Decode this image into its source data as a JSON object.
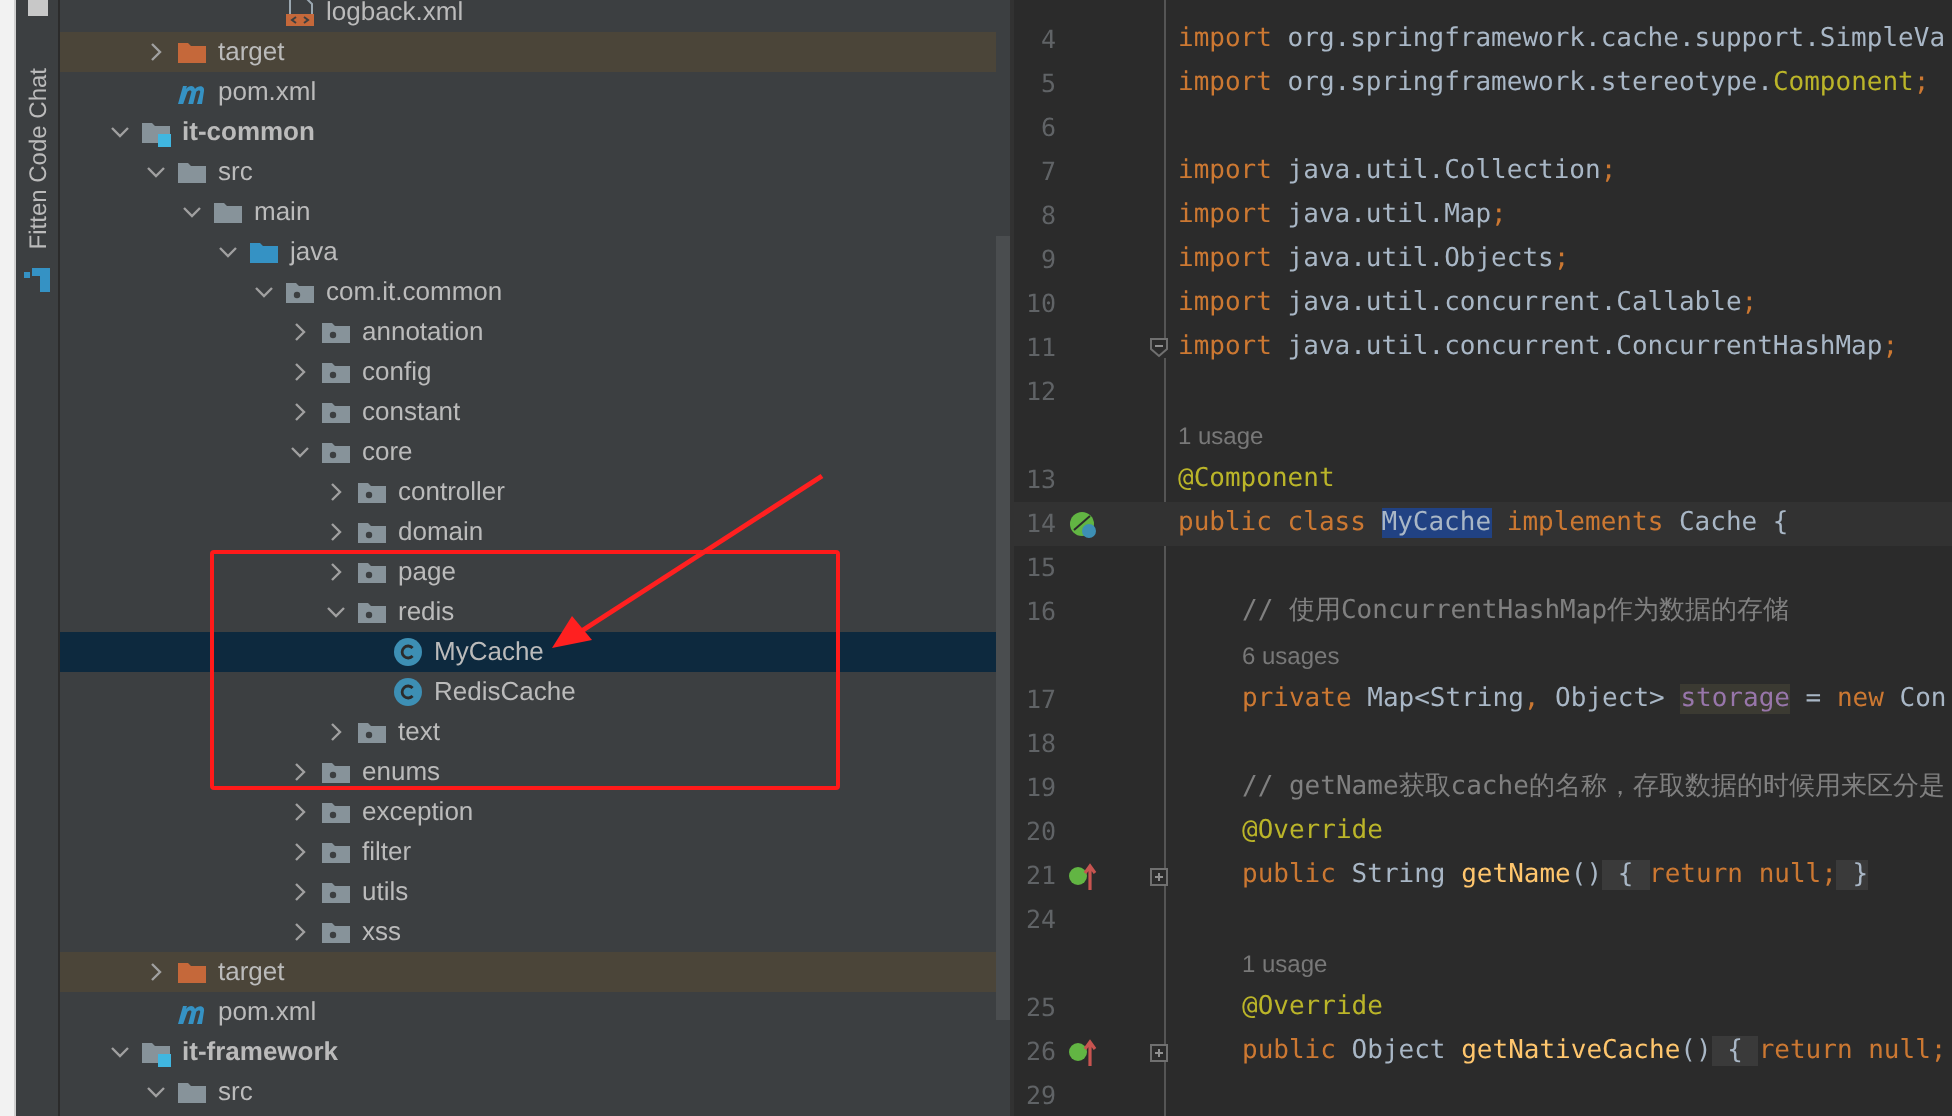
{
  "tool_strip": {
    "tabs": [
      {
        "label": "Fitten Code Chat"
      }
    ]
  },
  "project_tree": {
    "items": [
      {
        "children": [
          {
            "children": [
              {
                "children": [
                  {
                    "children": [
                      {
                        "label": "logback.xml",
                        "kind": "xml",
                        "selected": false
                      }
                    ]
                  }
                ]
              }
            ]
          },
          {
            "label": "target",
            "kind": "excluded-folder",
            "expanded": false,
            "selected": false
          },
          {
            "label": "pom.xml",
            "kind": "maven",
            "selected": false
          }
        ]
      },
      {
        "label": "it-common",
        "kind": "module",
        "expanded": true,
        "selected": false,
        "children": [
          {
            "label": "src",
            "kind": "folder",
            "expanded": true,
            "selected": false,
            "children": [
              {
                "label": "main",
                "kind": "folder",
                "expanded": true,
                "selected": false,
                "children": [
                  {
                    "label": "java",
                    "kind": "source-folder",
                    "expanded": true,
                    "selected": false,
                    "children": [
                      {
                        "label": "com.it.common",
                        "kind": "package",
                        "expanded": true,
                        "selected": false,
                        "children": [
                          {
                            "label": "annotation",
                            "kind": "package",
                            "expanded": false,
                            "selected": false
                          },
                          {
                            "label": "config",
                            "kind": "package",
                            "expanded": false,
                            "selected": false
                          },
                          {
                            "label": "constant",
                            "kind": "package",
                            "expanded": false,
                            "selected": false
                          },
                          {
                            "label": "core",
                            "kind": "package",
                            "expanded": true,
                            "selected": false,
                            "children": [
                              {
                                "label": "controller",
                                "kind": "package",
                                "expanded": false,
                                "selected": false
                              },
                              {
                                "label": "domain",
                                "kind": "package",
                                "expanded": false,
                                "selected": false
                              },
                              {
                                "label": "page",
                                "kind": "package",
                                "expanded": false,
                                "selected": false
                              },
                              {
                                "label": "redis",
                                "kind": "package",
                                "expanded": true,
                                "selected": false,
                                "children": [
                                  {
                                    "label": "MyCache",
                                    "kind": "class",
                                    "selected": true
                                  },
                                  {
                                    "label": "RedisCache",
                                    "kind": "class",
                                    "selected": false
                                  }
                                ]
                              },
                              {
                                "label": "text",
                                "kind": "package",
                                "expanded": false,
                                "selected": false
                              }
                            ]
                          },
                          {
                            "label": "enums",
                            "kind": "package",
                            "expanded": false,
                            "selected": false
                          },
                          {
                            "label": "exception",
                            "kind": "package",
                            "expanded": false,
                            "selected": false
                          },
                          {
                            "label": "filter",
                            "kind": "package",
                            "expanded": false,
                            "selected": false
                          },
                          {
                            "label": "utils",
                            "kind": "package",
                            "expanded": false,
                            "selected": false
                          },
                          {
                            "label": "xss",
                            "kind": "package",
                            "expanded": false,
                            "selected": false
                          }
                        ]
                      }
                    ]
                  }
                ]
              }
            ]
          },
          {
            "label": "target",
            "kind": "excluded-folder",
            "expanded": false,
            "selected": false
          },
          {
            "label": "pom.xml",
            "kind": "maven",
            "selected": false
          }
        ]
      },
      {
        "label": "it-framework",
        "kind": "module",
        "expanded": true,
        "selected": false,
        "children": [
          {
            "label": "src",
            "kind": "folder",
            "expanded": true,
            "selected": false
          }
        ]
      }
    ]
  },
  "editor": {
    "lines": [
      {
        "kind": "code",
        "number": "4",
        "tokens": [
          {
            "kind": "keyword",
            "text": "import "
          },
          {
            "kind": "text",
            "text": "org.springframework.cache.support.SimpleVa"
          }
        ]
      },
      {
        "kind": "code",
        "number": "5",
        "tokens": [
          {
            "kind": "keyword",
            "text": "import "
          },
          {
            "kind": "text",
            "text": "org.springframework.stereotype."
          },
          {
            "kind": "annotation",
            "text": "Component"
          },
          {
            "kind": "keyword",
            "text": ";"
          }
        ]
      },
      {
        "kind": "code",
        "number": "6"
      },
      {
        "kind": "code",
        "number": "7",
        "tokens": [
          {
            "kind": "keyword",
            "text": "import "
          },
          {
            "kind": "text",
            "text": "java.util.Collection"
          },
          {
            "kind": "keyword",
            "text": ";"
          }
        ]
      },
      {
        "kind": "code",
        "number": "8",
        "tokens": [
          {
            "kind": "keyword",
            "text": "import "
          },
          {
            "kind": "text",
            "text": "java.util.Map"
          },
          {
            "kind": "keyword",
            "text": ";"
          }
        ]
      },
      {
        "kind": "code",
        "number": "9",
        "tokens": [
          {
            "kind": "keyword",
            "text": "import "
          },
          {
            "kind": "text",
            "text": "java.util.Objects"
          },
          {
            "kind": "keyword",
            "text": ";"
          }
        ]
      },
      {
        "kind": "code",
        "number": "10",
        "tokens": [
          {
            "kind": "keyword",
            "text": "import "
          },
          {
            "kind": "text",
            "text": "java.util.concurrent.Callable"
          },
          {
            "kind": "keyword",
            "text": ";"
          }
        ]
      },
      {
        "kind": "code",
        "number": "11",
        "fold": {
          "kind": "end"
        },
        "tokens": [
          {
            "kind": "keyword",
            "text": "import "
          },
          {
            "kind": "text",
            "text": "java.util.concurrent.ConcurrentHashMap"
          },
          {
            "kind": "keyword",
            "text": ";"
          }
        ]
      },
      {
        "kind": "code",
        "number": "12"
      },
      {
        "kind": "hint",
        "text": "1 usage"
      },
      {
        "kind": "code",
        "number": "13",
        "tokens": [
          {
            "kind": "annotation",
            "text": "@Component"
          }
        ]
      },
      {
        "kind": "code",
        "number": "14",
        "current": true,
        "gutter_icon": {
          "kind": "bean"
        },
        "tokens": [
          {
            "kind": "keyword",
            "text": "public class "
          },
          {
            "kind": "selection",
            "text": "MyCache"
          },
          {
            "kind": "keyword",
            "text": " implements "
          },
          {
            "kind": "text",
            "text": "Cache {"
          }
        ]
      },
      {
        "kind": "code",
        "number": "15"
      },
      {
        "kind": "code",
        "number": "16",
        "indented": true,
        "tokens": [
          {
            "kind": "comment",
            "text": "// 使用ConcurrentHashMap作为数据的存储"
          }
        ]
      },
      {
        "kind": "hint",
        "indented": true,
        "text": "6 usages"
      },
      {
        "kind": "code",
        "number": "17",
        "indented": true,
        "tokens": [
          {
            "kind": "keyword",
            "text": "private "
          },
          {
            "kind": "text",
            "text": "Map<String"
          },
          {
            "kind": "keyword",
            "text": ","
          },
          {
            "kind": "text",
            "text": " Object> "
          },
          {
            "kind": "field-highlight",
            "text": "storage"
          },
          {
            "kind": "text",
            "text": " = "
          },
          {
            "kind": "keyword",
            "text": "new "
          },
          {
            "kind": "text",
            "text": "Con"
          }
        ]
      },
      {
        "kind": "code",
        "number": "18"
      },
      {
        "kind": "code",
        "number": "19",
        "indented": true,
        "tokens": [
          {
            "kind": "comment",
            "text": "// getName获取cache的名称，存取数据的时候用来区分是"
          }
        ]
      },
      {
        "kind": "code",
        "number": "20",
        "indented": true,
        "tokens": [
          {
            "kind": "annotation",
            "text": "@Override"
          }
        ]
      },
      {
        "kind": "code",
        "number": "21",
        "indented": true,
        "gutter_icon": {
          "kind": "override"
        },
        "fold": {
          "kind": "collapsed"
        },
        "tokens": [
          {
            "kind": "keyword",
            "text": "public "
          },
          {
            "kind": "text",
            "text": "String "
          },
          {
            "kind": "method",
            "text": "getName"
          },
          {
            "kind": "text",
            "text": "()"
          },
          {
            "kind": "folded",
            "text": " { "
          },
          {
            "kind": "keyword",
            "text": "return null;"
          },
          {
            "kind": "folded",
            "text": " }"
          }
        ]
      },
      {
        "kind": "code",
        "number": "24"
      },
      {
        "kind": "hint",
        "indented": true,
        "text": "1 usage"
      },
      {
        "kind": "code",
        "number": "25",
        "indented": true,
        "tokens": [
          {
            "kind": "annotation",
            "text": "@Override"
          }
        ]
      },
      {
        "kind": "code",
        "number": "26",
        "indented": true,
        "gutter_icon": {
          "kind": "override"
        },
        "fold": {
          "kind": "collapsed"
        },
        "tokens": [
          {
            "kind": "keyword",
            "text": "public "
          },
          {
            "kind": "text",
            "text": "Object "
          },
          {
            "kind": "method",
            "text": "getNativeCache"
          },
          {
            "kind": "text",
            "text": "()"
          },
          {
            "kind": "folded",
            "text": " { "
          },
          {
            "kind": "keyword",
            "text": "return null;"
          }
        ]
      },
      {
        "kind": "code",
        "number": "29"
      }
    ]
  }
}
